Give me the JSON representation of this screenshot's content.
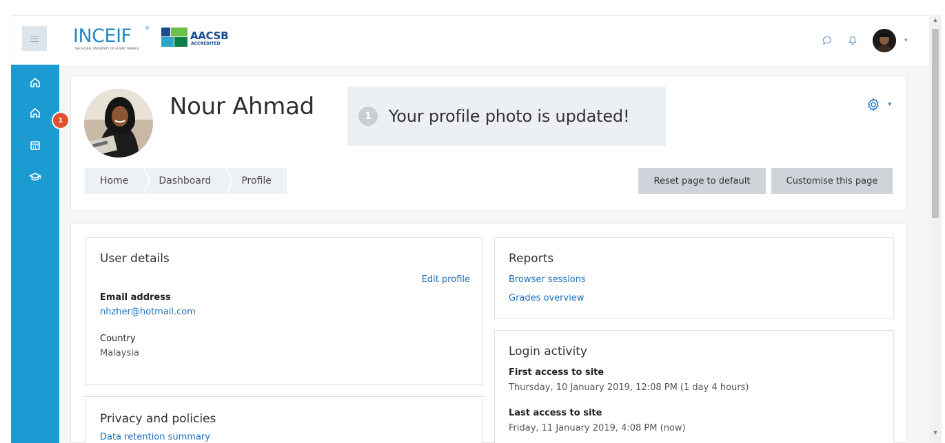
{
  "brand": {
    "inceif": "INCEIF",
    "inceif_reg": "®",
    "inceif_tagline": "THE GLOBAL UNIVERSITY OF ISLAMIC FINANCE",
    "aacsb": "AACSB",
    "aacsb_sub": "ACCREDITED",
    "primary_color": "#1b9bd1",
    "link_color": "#1d6fb8"
  },
  "navbar": {
    "icons": [
      "message-icon",
      "bell-icon"
    ],
    "caret": "▾"
  },
  "sidebar": {
    "items": [
      "home-icon",
      "dashboard-icon",
      "calendar-icon",
      "courses-icon"
    ],
    "badge": "1"
  },
  "profile": {
    "name": "Nour Ahmad"
  },
  "alert": {
    "number": "1",
    "text": "Your profile photo is updated!"
  },
  "breadcrumb": [
    "Home",
    "Dashboard",
    "Profile"
  ],
  "buttons": {
    "reset": "Reset page to default",
    "customise": "Customise this page"
  },
  "user_details": {
    "title": "User details",
    "edit": "Edit profile",
    "email_label": "Email address",
    "email_value": "nhzher@hotmail.com",
    "country_label": "Country",
    "country_value": "Malaysia"
  },
  "privacy": {
    "title": "Privacy and policies",
    "link": "Data retention summary"
  },
  "reports": {
    "title": "Reports",
    "links": [
      "Browser sessions",
      "Grades overview"
    ]
  },
  "login": {
    "title": "Login activity",
    "first_label": "First access to site",
    "first_value": "Thursday, 10 January 2019, 12:08 PM  (1 day 4 hours)",
    "last_label": "Last access to site",
    "last_value": "Friday, 11 January 2019, 4:08 PM  (now)"
  }
}
